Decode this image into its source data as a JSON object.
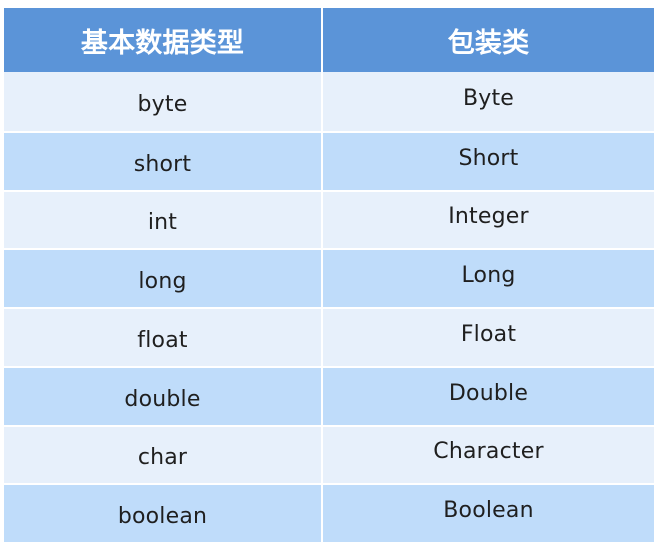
{
  "table": {
    "headers": [
      "基本数据类型",
      "包装类"
    ],
    "rows": [
      {
        "primitive": "byte",
        "wrapper": "Byte"
      },
      {
        "primitive": "short",
        "wrapper": "Short"
      },
      {
        "primitive": "int",
        "wrapper": "Integer"
      },
      {
        "primitive": "long",
        "wrapper": "Long"
      },
      {
        "primitive": "float",
        "wrapper": "Float"
      },
      {
        "primitive": "double",
        "wrapper": "Double"
      },
      {
        "primitive": "char",
        "wrapper": "Character"
      },
      {
        "primitive": "boolean",
        "wrapper": "Boolean"
      }
    ]
  },
  "colors": {
    "header_bg": "#5b94d8",
    "row_light": "#e7f0fb",
    "row_dark": "#bfdcfa",
    "header_text": "#ffffff",
    "cell_text": "#1f1f1f"
  }
}
